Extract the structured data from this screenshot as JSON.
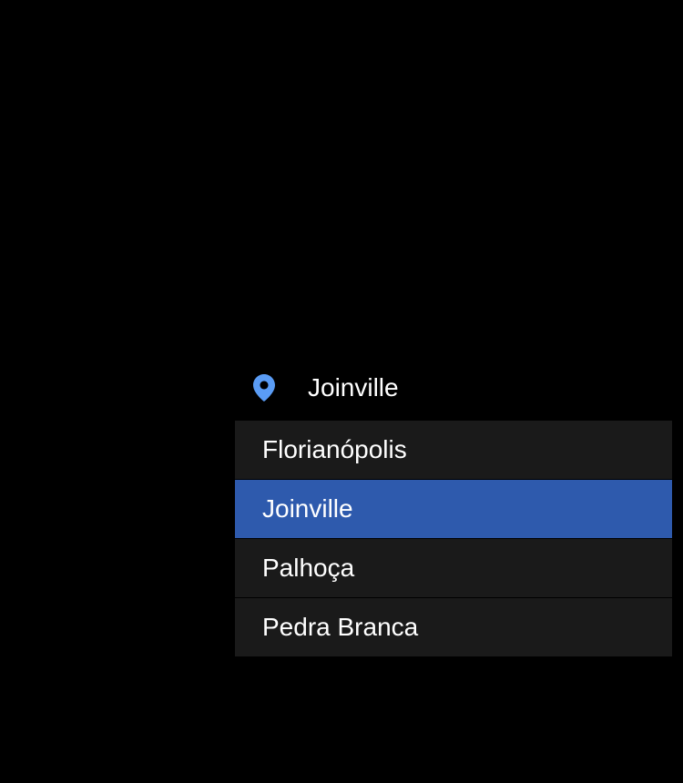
{
  "location_selector": {
    "icon_color": "#5a9cf5",
    "selected_value": "Joinville",
    "highlight_color": "#2e5aad",
    "options": [
      {
        "label": "Florianópolis",
        "selected": false
      },
      {
        "label": "Joinville",
        "selected": true
      },
      {
        "label": "Palhoça",
        "selected": false
      },
      {
        "label": "Pedra Branca",
        "selected": false
      }
    ]
  }
}
